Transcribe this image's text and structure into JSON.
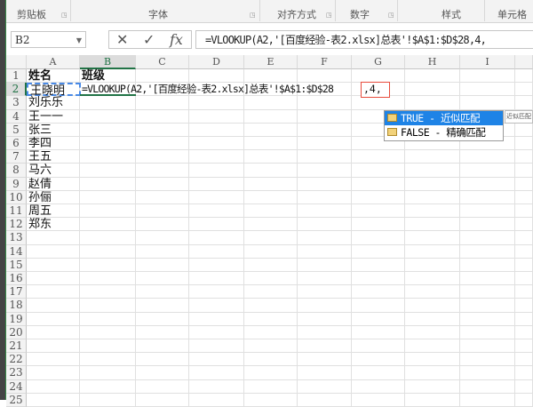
{
  "ribbon": {
    "groups": [
      "剪贴板",
      "字体",
      "对齐方式",
      "数字",
      "样式",
      "单元格"
    ]
  },
  "formula_bar": {
    "name_box": "B2",
    "cancel": "✕",
    "enter": "✓",
    "fx": "fx",
    "formula": "=VLOOKUP(A2,'[百度经验-表2.xlsx]总表'!$A$1:$D$28,4,"
  },
  "columns": [
    "A",
    "B",
    "C",
    "D",
    "E",
    "F",
    "G",
    "H",
    "I"
  ],
  "rows": [
    "1",
    "2",
    "3",
    "4",
    "5",
    "6",
    "7",
    "8",
    "9",
    "10",
    "11",
    "12",
    "13",
    "14",
    "15",
    "16",
    "17",
    "18",
    "19",
    "20",
    "21",
    "22",
    "23",
    "24",
    "25"
  ],
  "cells": {
    "A1": "姓名",
    "B1": "班级",
    "A2": "王晓明",
    "B2_pre": "=VLOOKUP(A2,'[百度经验-表2.xlsx]总表'!$A$1:$D$28",
    "B2_post": ",4,",
    "A": [
      "刘乐乐",
      "王一一",
      "张三",
      "李四",
      "王五",
      "马六",
      "赵倩",
      "孙俪",
      "周五",
      "郑东"
    ]
  },
  "autocomplete": {
    "items": [
      "TRUE - 近似匹配",
      "FALSE - 精确匹配"
    ],
    "selected": 0,
    "tooltip": "近似匹配"
  }
}
